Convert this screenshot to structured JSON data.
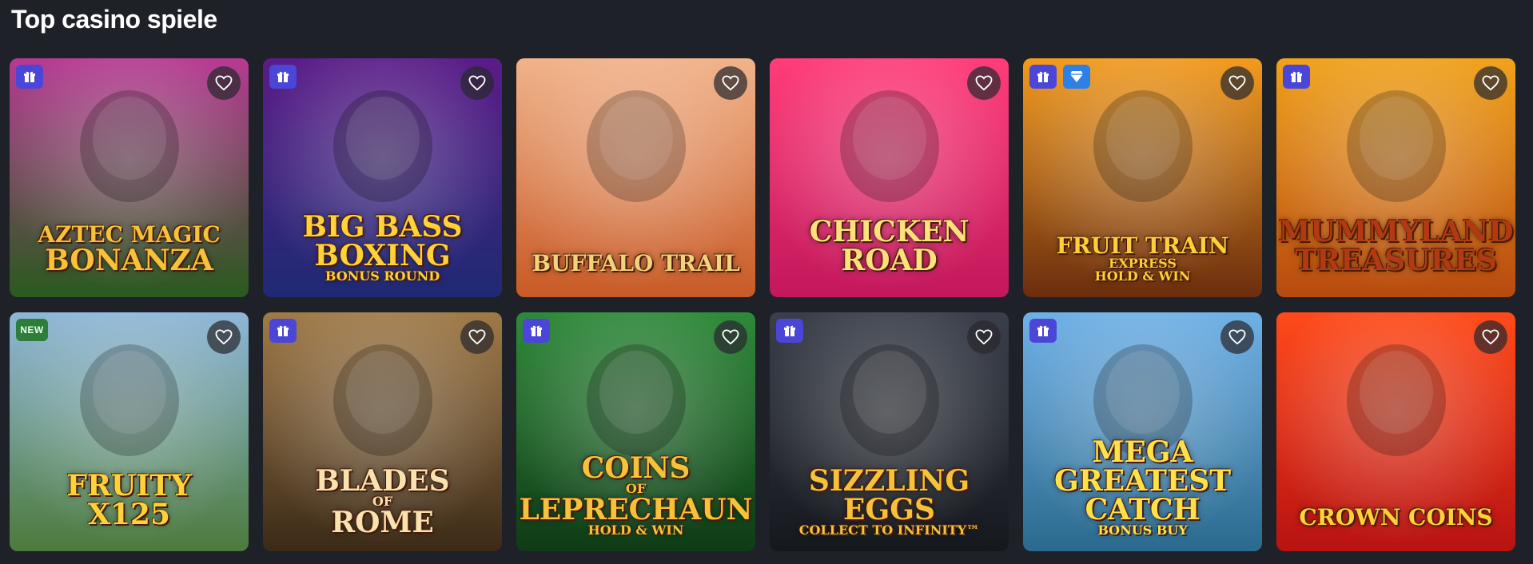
{
  "section": {
    "title": "Top casino spiele"
  },
  "badges": {
    "new_label": "NEW"
  },
  "games": [
    {
      "logo": [
        "Aztec Magic",
        "Bonanza"
      ],
      "bg": [
        "#b73a93",
        "#2a5a1e"
      ],
      "accent": "#f5c23a",
      "badges": [
        "gift"
      ]
    },
    {
      "logo": [
        "Big Bass",
        "Boxing",
        "Bonus Round"
      ],
      "bg": [
        "#5b1c88",
        "#1f2a74"
      ],
      "accent": "#ffd23a",
      "badges": [
        "gift"
      ]
    },
    {
      "logo": [
        "Buffalo Trail"
      ],
      "bg": [
        "#f1b38a",
        "#c85a26"
      ],
      "accent": "#f2d27a",
      "badges": []
    },
    {
      "logo": [
        "Chicken",
        "Road"
      ],
      "bg": [
        "#ff3d7a",
        "#c2185b"
      ],
      "accent": "#ffe07a",
      "badges": []
    },
    {
      "logo": [
        "Fruit Train",
        "Express",
        "Hold & Win"
      ],
      "bg": [
        "#f29b1f",
        "#6b2d0e"
      ],
      "accent": "#ffcf3a",
      "badges": [
        "gift",
        "diamond"
      ]
    },
    {
      "logo": [
        "Mummyland",
        "Treasures"
      ],
      "bg": [
        "#f0a21c",
        "#b74a0f"
      ],
      "accent": "#b23a12",
      "badges": [
        "gift"
      ]
    },
    {
      "logo": [
        "Fruity",
        "x125"
      ],
      "bg": [
        "#8eb7d8",
        "#4d7a3c"
      ],
      "accent": "#ffd23a",
      "badges": [
        "new"
      ]
    },
    {
      "logo": [
        "Blades",
        "of",
        "Rome"
      ],
      "bg": [
        "#a07a48",
        "#3b2a18"
      ],
      "accent": "#f7e2b0",
      "badges": [
        "gift"
      ]
    },
    {
      "logo": [
        "Coins",
        "of",
        "Leprechaun",
        "Hold & Win"
      ],
      "bg": [
        "#2f8a3a",
        "#0f3b16"
      ],
      "accent": "#f5c23a",
      "badges": [
        "gift"
      ]
    },
    {
      "logo": [
        "Sizzling",
        "Eggs",
        "Collect to Infinity™"
      ],
      "bg": [
        "#3a3f4a",
        "#15181d"
      ],
      "accent": "#f5c23a",
      "badges": [
        "gift"
      ]
    },
    {
      "logo": [
        "Mega",
        "Greatest",
        "Catch",
        "Bonus Buy"
      ],
      "bg": [
        "#6fb0e6",
        "#2b6a8e"
      ],
      "accent": "#ffe14a",
      "badges": [
        "gift"
      ]
    },
    {
      "logo": [
        "Crown Coins"
      ],
      "bg": [
        "#ff4a1a",
        "#b81212"
      ],
      "accent": "#ffd23a",
      "badges": []
    }
  ]
}
